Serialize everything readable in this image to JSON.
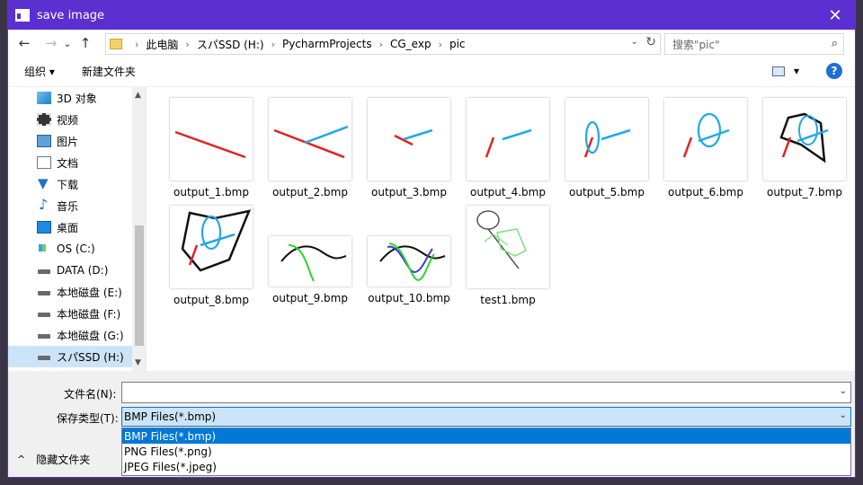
{
  "window": {
    "title": "save image",
    "close_glyph": "✕"
  },
  "nav": {
    "back": "←",
    "forward": "→",
    "recent": "⌄",
    "up": "↑"
  },
  "address": {
    "crumbs": [
      "此电脑",
      "スパSSD (H:)",
      "PycharmProjects",
      "CG_exp",
      "pic"
    ],
    "separator": "›",
    "dropdown": "⌄",
    "refresh": "↻"
  },
  "search": {
    "placeholder": "搜索\"pic\"",
    "icon": "⌕"
  },
  "toolbar": {
    "organize": "组织 ▾",
    "new_folder": "新建文件夹",
    "view_dd": "▾",
    "help": "?"
  },
  "sidebar": {
    "items": [
      {
        "label": "3D 对象",
        "icon": "3d-objects-icon"
      },
      {
        "label": "视频",
        "icon": "video-icon"
      },
      {
        "label": "图片",
        "icon": "pictures-icon"
      },
      {
        "label": "文档",
        "icon": "documents-icon"
      },
      {
        "label": "下载",
        "icon": "downloads-icon"
      },
      {
        "label": "音乐",
        "icon": "music-icon"
      },
      {
        "label": "桌面",
        "icon": "desktop-icon"
      },
      {
        "label": "OS (C:)",
        "icon": "os-drive-icon"
      },
      {
        "label": "DATA (D:)",
        "icon": "drive-icon"
      },
      {
        "label": "本地磁盘 (E:)",
        "icon": "drive-icon"
      },
      {
        "label": "本地磁盘 (F:)",
        "icon": "drive-icon"
      },
      {
        "label": "本地磁盘 (G:)",
        "icon": "drive-icon"
      },
      {
        "label": "スパSSD (H:)",
        "icon": "drive-icon",
        "selected": true
      }
    ],
    "scroll_up": "▲",
    "scroll_down": "▼"
  },
  "files": [
    {
      "name": "output_1.bmp"
    },
    {
      "name": "output_2.bmp"
    },
    {
      "name": "output_3.bmp"
    },
    {
      "name": "output_4.bmp"
    },
    {
      "name": "output_5.bmp"
    },
    {
      "name": "output_6.bmp"
    },
    {
      "name": "output_7.bmp"
    },
    {
      "name": "output_8.bmp"
    },
    {
      "name": "output_9.bmp"
    },
    {
      "name": "output_10.bmp"
    },
    {
      "name": "test1.bmp"
    }
  ],
  "form": {
    "filename_label": "文件名(N):",
    "filename_value": "",
    "filetype_label": "保存类型(T):",
    "filetype_value": "BMP Files(*.bmp)",
    "dd_glyph": "⌄",
    "options": [
      "BMP Files(*.bmp)",
      "PNG Files(*.png)",
      "JPEG Files(*.jpeg)"
    ],
    "hide_folders": "隐藏文件夹",
    "hide_chevron": "^"
  },
  "colors": {
    "titlebar": "#5b2fd0",
    "selection": "#0078d7",
    "hover": "#cce4f7"
  }
}
